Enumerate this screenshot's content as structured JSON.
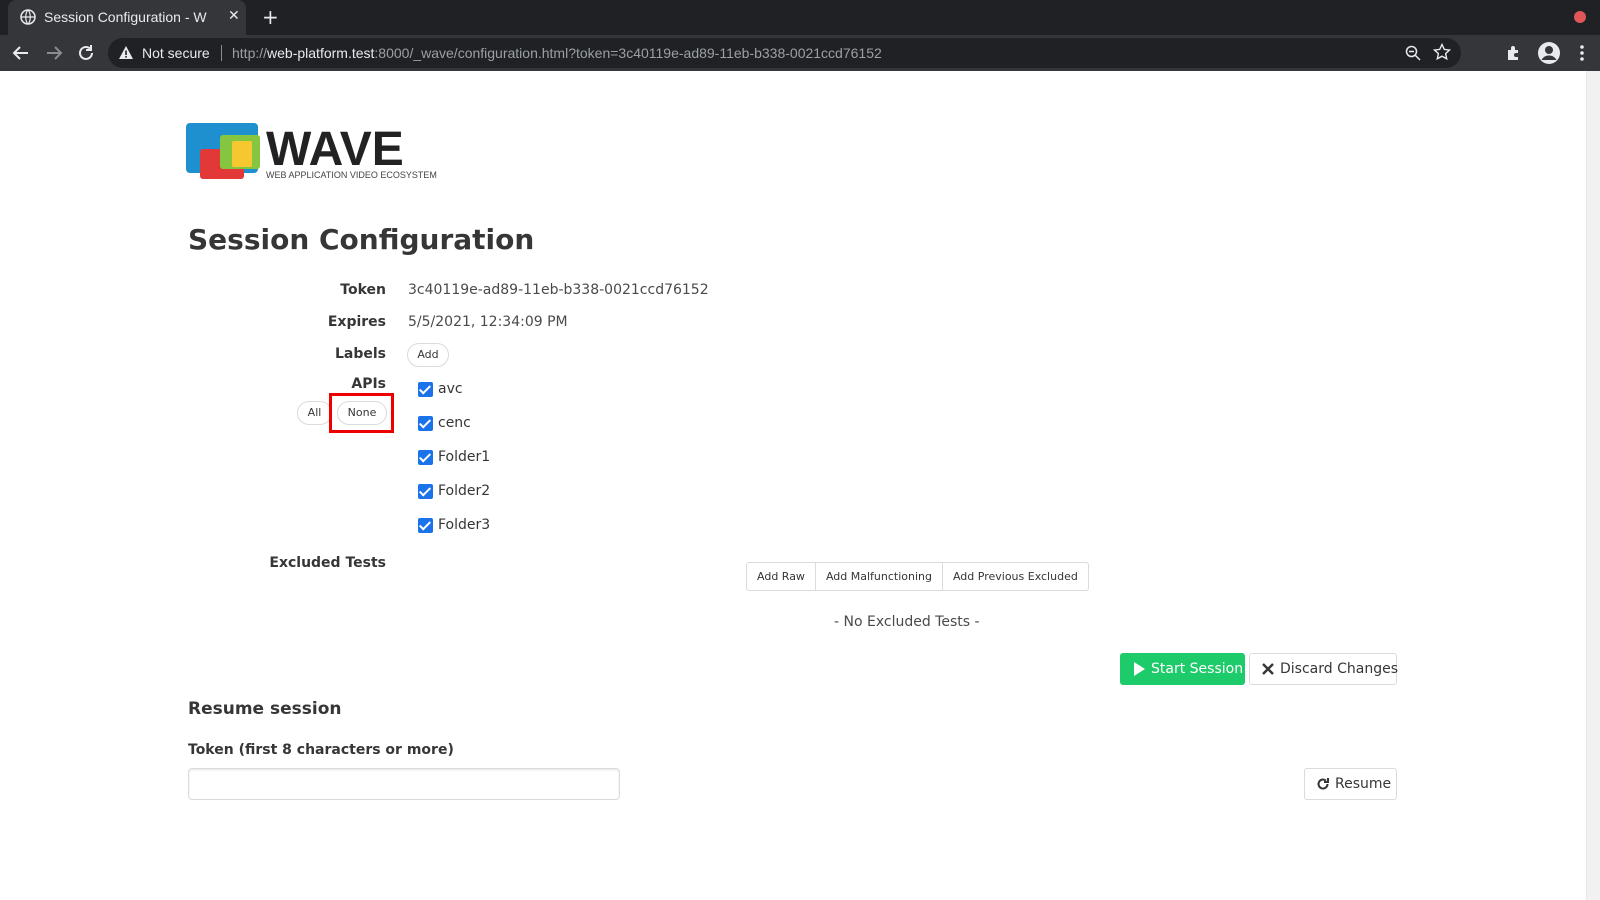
{
  "browser": {
    "tab_title": "Session Configuration - W",
    "security_label": "Not secure",
    "url_prefix": "http://",
    "url_host": "web-platform.test",
    "url_rest": ":8000/_wave/configuration.html?token=3c40119e-ad89-11eb-b338-0021ccd76152"
  },
  "logo": {
    "wordmark": "WAVE",
    "tagline": "WEB APPLICATION VIDEO ECOSYSTEM"
  },
  "page": {
    "title": "Session Configuration"
  },
  "config": {
    "token_label": "Token",
    "token_value": "3c40119e-ad89-11eb-b338-0021ccd76152",
    "expires_label": "Expires",
    "expires_value": "5/5/2021, 12:34:09 PM",
    "labels_label": "Labels",
    "labels_add": "Add",
    "apis_label": "APIs",
    "apis_all": "All",
    "apis_none": "None",
    "apis": [
      {
        "label": "avc",
        "checked": true
      },
      {
        "label": "cenc",
        "checked": true
      },
      {
        "label": "Folder1",
        "checked": true
      },
      {
        "label": "Folder2",
        "checked": true
      },
      {
        "label": "Folder3",
        "checked": true
      }
    ],
    "excluded_label": "Excluded Tests",
    "excluded_buttons": [
      "Add Raw",
      "Add Malfunctioning",
      "Add Previous Excluded"
    ],
    "no_excluded": "- No Excluded Tests -",
    "start_session": "Start Session",
    "discard_changes": "Discard Changes"
  },
  "resume": {
    "title": "Resume session",
    "token_label": "Token (first 8 characters or more)",
    "token_value": "",
    "resume_button": "Resume"
  },
  "colors": {
    "start_button": "#1ecb6a",
    "checkbox": "#1a73e8",
    "highlight": "#ee0000"
  }
}
